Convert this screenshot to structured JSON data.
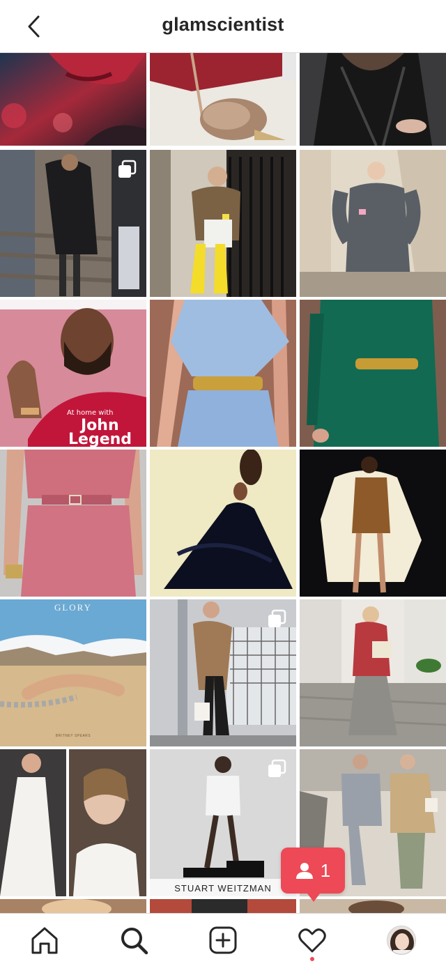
{
  "header": {
    "title": "glamscientist",
    "back_icon": "chevron-left-icon"
  },
  "grid": {
    "posts": [
      {
        "name": "post-red-lips",
        "multi": false
      },
      {
        "name": "post-fur-heels",
        "multi": false
      },
      {
        "name": "post-leather-coat",
        "multi": false
      },
      {
        "name": "post-leather-trench",
        "multi": true
      },
      {
        "name": "post-yellow-boots",
        "multi": false
      },
      {
        "name": "post-grey-coat",
        "multi": false
      },
      {
        "name": "post-john-legend-cover",
        "multi": false,
        "caption_small": "At home with",
        "caption_big_1": "John",
        "caption_big_2": "Legend"
      },
      {
        "name": "post-blue-dress",
        "multi": false
      },
      {
        "name": "post-green-dress",
        "multi": false
      },
      {
        "name": "post-pink-dress",
        "multi": false
      },
      {
        "name": "post-black-gown",
        "multi": false
      },
      {
        "name": "post-satin-slip",
        "multi": false
      },
      {
        "name": "post-glory-cover",
        "multi": false,
        "caption_top": "GLORY",
        "caption_bottom": "BRITNEY SPEARS"
      },
      {
        "name": "post-camel-coat",
        "multi": true
      },
      {
        "name": "post-plaid-jacket",
        "multi": false
      },
      {
        "name": "post-white-halter",
        "multi": false
      },
      {
        "name": "post-stuart-weitzman",
        "multi": true,
        "caption": "STUART WEITZMAN"
      },
      {
        "name": "post-suits-street",
        "multi": false
      }
    ]
  },
  "notification": {
    "count": "1",
    "icon": "person-icon",
    "color": "#ed4956"
  },
  "bottom_nav": {
    "items": [
      {
        "name": "home",
        "icon": "home-icon"
      },
      {
        "name": "search",
        "icon": "search-icon"
      },
      {
        "name": "new-post",
        "icon": "plus-square-icon"
      },
      {
        "name": "activity",
        "icon": "heart-icon"
      },
      {
        "name": "profile",
        "icon": "avatar"
      }
    ]
  }
}
